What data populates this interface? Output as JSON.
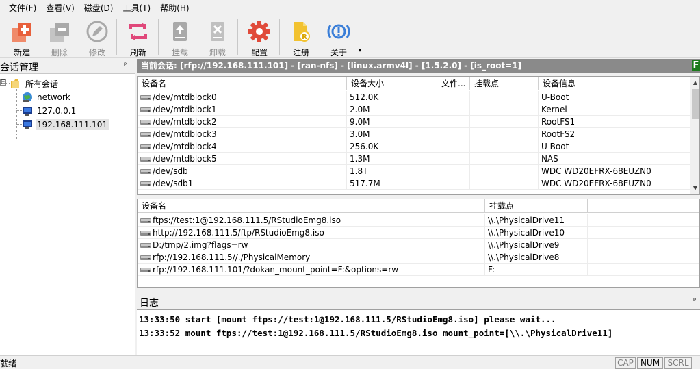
{
  "menu": [
    {
      "label": "文件(F)"
    },
    {
      "label": "查看(V)"
    },
    {
      "label": "磁盘(D)"
    },
    {
      "label": "工具(T)"
    },
    {
      "label": "帮助(H)"
    }
  ],
  "toolbar": {
    "new": "新建",
    "delete": "删除",
    "edit": "修改",
    "refresh": "刷新",
    "mount": "挂载",
    "unmount": "卸载",
    "config": "配置",
    "register": "注册",
    "about": "关于",
    "more": "▾"
  },
  "sessions": {
    "title": "会话管理",
    "pin": "ᵖ",
    "expander": "⊟",
    "root": "所有会话",
    "items": [
      "network",
      "127.0.0.1",
      "192.168.111.101"
    ]
  },
  "session_bar": {
    "text": "当前会话: [rfp://192.168.111.101] - [ran-nfs] - [linux.armv4l] - [1.5.2.0] - [is_root=1]",
    "badge": "F"
  },
  "devices": {
    "headers": [
      "设备名",
      "设备大小",
      "文件...",
      "挂载点",
      "设备信息"
    ],
    "rows": [
      {
        "name": "/dev/mtdblock0",
        "size": "512.0K",
        "fs": "",
        "mount": "",
        "info": "U-Boot"
      },
      {
        "name": "/dev/mtdblock1",
        "size": "2.0M",
        "fs": "",
        "mount": "",
        "info": "Kernel"
      },
      {
        "name": "/dev/mtdblock2",
        "size": "9.0M",
        "fs": "",
        "mount": "",
        "info": "RootFS1"
      },
      {
        "name": "/dev/mtdblock3",
        "size": "3.0M",
        "fs": "",
        "mount": "",
        "info": "RootFS2"
      },
      {
        "name": "/dev/mtdblock4",
        "size": "256.0K",
        "fs": "",
        "mount": "",
        "info": "U-Boot"
      },
      {
        "name": "/dev/mtdblock5",
        "size": "1.3M",
        "fs": "",
        "mount": "",
        "info": "NAS"
      },
      {
        "name": "/dev/sdb",
        "size": "1.8T",
        "fs": "",
        "mount": "",
        "info": "WDC WD20EFRX-68EUZN0"
      },
      {
        "name": "/dev/sdb1",
        "size": "517.7M",
        "fs": "",
        "mount": "",
        "info": "WDC WD20EFRX-68EUZN0"
      }
    ],
    "scroll_up": "▲",
    "scroll_down": "▼"
  },
  "mounts": {
    "headers": [
      "设备名",
      "挂载点"
    ],
    "rows": [
      {
        "name": "ftps://test:1@192.168.111.5/RStudioEmg8.iso",
        "mount": "\\\\.\\PhysicalDrive11"
      },
      {
        "name": "http://192.168.111.5/ftp/RStudioEmg8.iso",
        "mount": "\\\\.\\PhysicalDrive10"
      },
      {
        "name": "D:/tmp/2.img?flags=rw",
        "mount": "\\\\.\\PhysicalDrive9"
      },
      {
        "name": "rfp://192.168.111.5//./PhysicalMemory",
        "mount": "\\\\.\\PhysicalDrive8"
      },
      {
        "name": "rfp://192.168.111.101/?dokan_mount_point=F:&options=rw",
        "mount": "F:"
      }
    ]
  },
  "log": {
    "title": "日志",
    "pin": "ᵖ",
    "lines": [
      "13:33:50 start [mount ftps://test:1@192.168.111.5/RStudioEmg8.iso] please wait...",
      "13:33:52 mount ftps://test:1@192.168.111.5/RStudioEmg8.iso mount_point=[\\\\.\\PhysicalDrive11]"
    ]
  },
  "status": {
    "text": "就绪",
    "cap": "CAP",
    "num": "NUM",
    "scrl": "SCRL"
  },
  "colors": {
    "session_bar": "#8a8a8a",
    "new_icon": "#e8603c",
    "refresh_icon": "#e0487a",
    "config_icon": "#e04a3a",
    "register_icon": "#f2c230",
    "about_icon": "#3a7ed8"
  }
}
